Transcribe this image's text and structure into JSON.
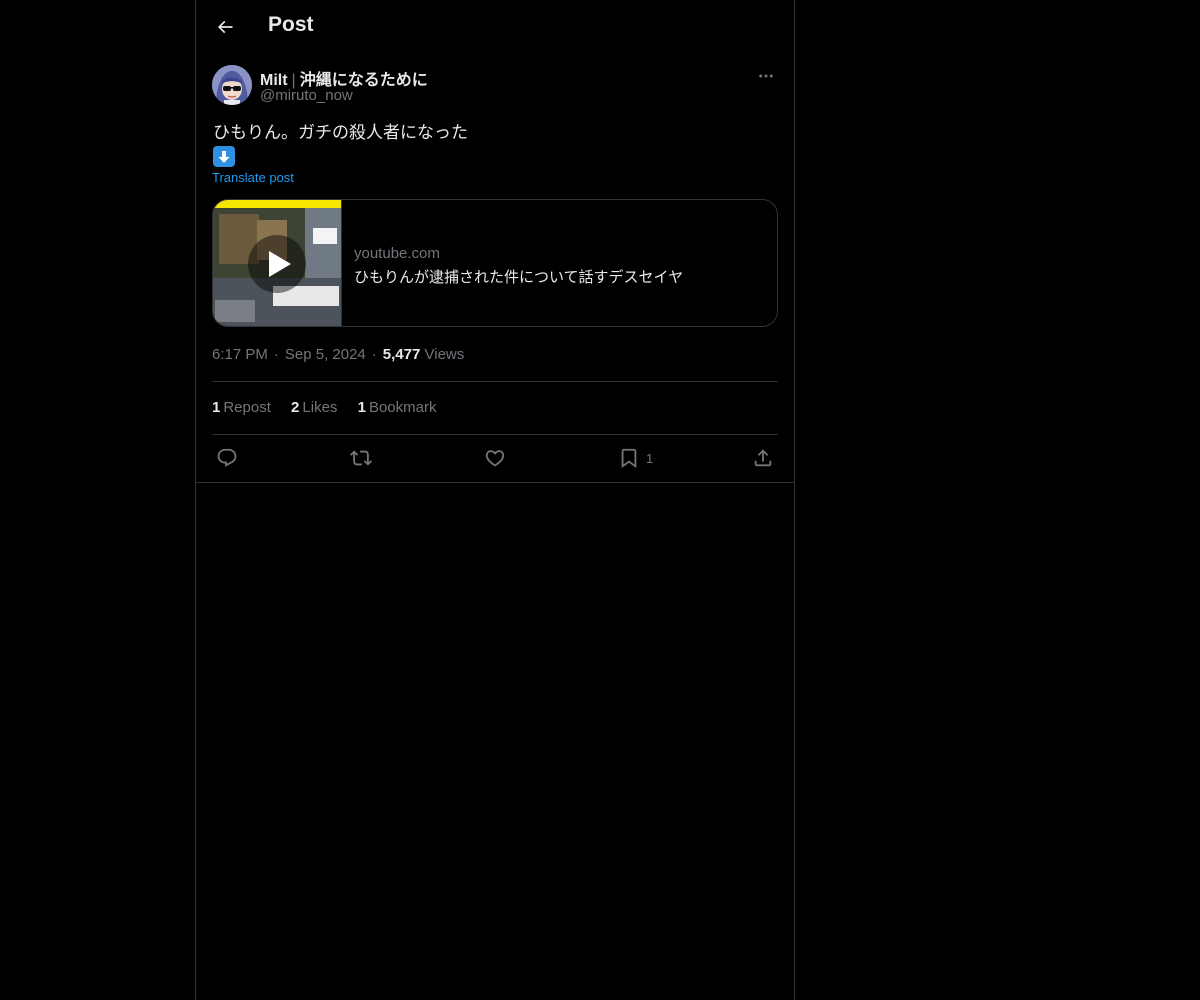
{
  "header": {
    "title": "Post",
    "back_icon": "arrow-left-icon"
  },
  "post": {
    "author": {
      "display_name": "Milt",
      "separator": "|",
      "name_suffix": "沖縄になるために",
      "handle": "@miruto_now"
    },
    "text": "ひもりん。ガチの殺人者になった",
    "emoji": "down-arrow-emoji",
    "translate_label": "Translate post",
    "card": {
      "domain": "youtube.com",
      "title": "ひもりんが逮捕された件について話すデスセイヤ"
    },
    "meta": {
      "time": "6:17 PM",
      "date": "Sep 5, 2024",
      "dot": "·",
      "views_count": "5,477",
      "views_label": "Views"
    },
    "stats": {
      "reposts_count": "1",
      "reposts_label": "Repost",
      "likes_count": "2",
      "likes_label": "Likes",
      "bookmarks_count": "1",
      "bookmarks_label": "Bookmark"
    },
    "actions": {
      "reply_icon": "reply-icon",
      "repost_icon": "repost-icon",
      "like_icon": "heart-icon",
      "bookmark_icon": "bookmark-icon",
      "bookmark_count": "1",
      "share_icon": "share-icon"
    }
  },
  "colors": {
    "background": "#000000",
    "text": "#e7e9ea",
    "secondary": "#71767b",
    "link": "#1d9bf0",
    "border": "#2f3336"
  }
}
